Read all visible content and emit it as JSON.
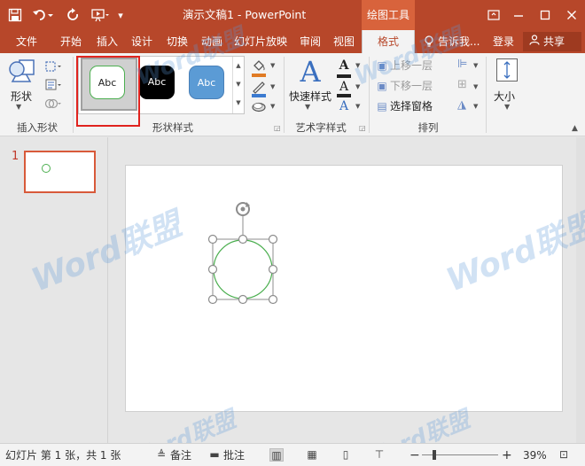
{
  "qat": {
    "save_icon": "save-icon",
    "undo_icon": "undo-icon",
    "redo_icon": "redo-icon",
    "start_icon": "start-from-beginning-icon",
    "customize_icon": "customize-qat-icon"
  },
  "titlebar": {
    "title": "演示文稿1 - PowerPoint",
    "context_tab": "绘图工具"
  },
  "tabs": {
    "file": "文件",
    "home": "开始",
    "insert": "插入",
    "design": "设计",
    "transitions": "切换",
    "animations": "动画",
    "slideshow": "幻灯片放映",
    "review": "审阅",
    "view": "视图",
    "format": "格式"
  },
  "tell_me": "告诉我...",
  "login": "登录",
  "share": "共享",
  "ribbon": {
    "insert_shapes": {
      "label": "插入形状",
      "shapes_button": "形状"
    },
    "shape_styles": {
      "label": "形状样式",
      "swatches": [
        "Abc",
        "Abc",
        "Abc"
      ]
    },
    "wordart_styles": {
      "label": "艺术字样式",
      "quick_styles": "快速样式"
    },
    "arrange": {
      "label": "排列",
      "bring_forward": "上移一层",
      "send_backward": "下移一层",
      "selection_pane": "选择窗格"
    },
    "size": {
      "label": "大小"
    }
  },
  "thumbnail": {
    "number": "1"
  },
  "watermark_text": "Word联盟",
  "statusbar": {
    "slide_info": "幻灯片 第 1 张，共 1 张",
    "notes": "备注",
    "comments": "批注",
    "zoom_minus": "−",
    "zoom_plus": "+",
    "zoom": "39%",
    "zoom_fraction": 0.39
  },
  "colors": {
    "accent": "#b7472a",
    "highlight": "#e0231e",
    "circle": "#4caf50",
    "handle": "#8c8c8c"
  }
}
